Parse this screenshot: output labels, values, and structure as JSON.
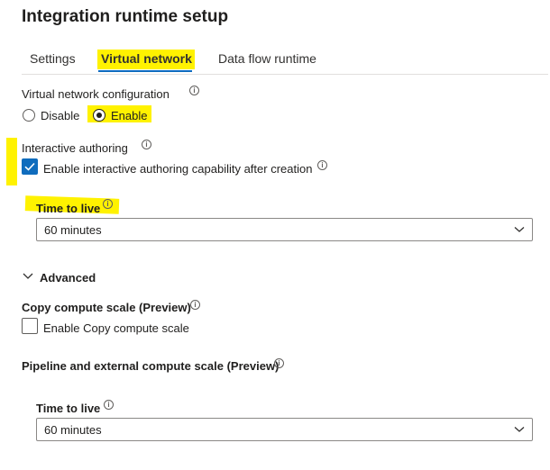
{
  "header": {
    "title": "Integration runtime setup"
  },
  "tabs": [
    {
      "label": "Settings"
    },
    {
      "label": "Virtual network"
    },
    {
      "label": "Data flow runtime"
    }
  ],
  "vnet": {
    "label": "Virtual network configuration",
    "options": [
      {
        "label": "Disable"
      },
      {
        "label": "Enable"
      }
    ],
    "selected": "Enable"
  },
  "interactive": {
    "label": "Interactive authoring",
    "checkbox_label": "Enable interactive authoring capability after creation",
    "checked": true,
    "ttl_label": "Time to live",
    "ttl_value": "60 minutes"
  },
  "advanced": {
    "label": "Advanced"
  },
  "copy_compute": {
    "label": "Copy compute scale (Preview)",
    "checkbox_label": "Enable Copy compute scale",
    "checked": false
  },
  "pipeline": {
    "label": "Pipeline and external compute scale (Preview)",
    "ttl_label": "Time to live",
    "ttl_value": "60 minutes"
  },
  "colors": {
    "accent": "#0f6cbd",
    "highlight": "#fff200"
  },
  "icons": [
    "info-icon",
    "checkmark-icon",
    "chevron-down-icon"
  ]
}
